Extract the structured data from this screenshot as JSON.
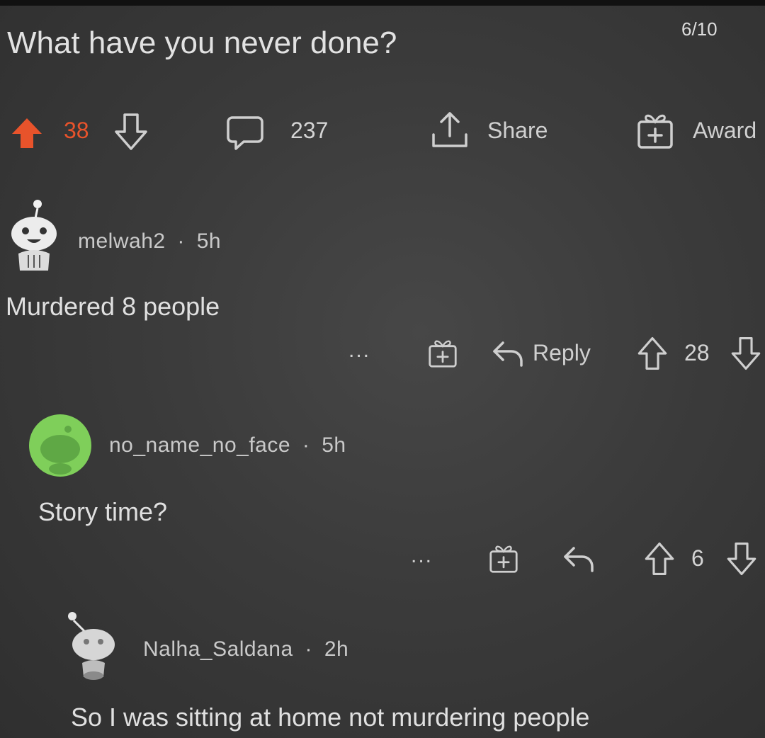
{
  "post": {
    "title": "What have you never done?",
    "page_counter": "6/10",
    "votes": "38",
    "comments": "237",
    "share_label": "Share",
    "award_label": "Award"
  },
  "comments": [
    {
      "username": "melwah2",
      "age": "5h",
      "text": "Murdered 8 people",
      "more_label": "...",
      "reply_label": "Reply",
      "votes": "28"
    },
    {
      "username": "no_name_no_face",
      "age": "5h",
      "text": "Story time?",
      "more_label": "...",
      "votes": "6"
    },
    {
      "username": "Nalha_Saldana",
      "age": "2h",
      "text": "So I was sitting at home not murdering people"
    }
  ],
  "separator": "·",
  "colors": {
    "upvote_active": "#e8532b",
    "avatar_green": "#7fcf5a",
    "background": "#3d3d3d",
    "text": "#d8d8d8"
  }
}
